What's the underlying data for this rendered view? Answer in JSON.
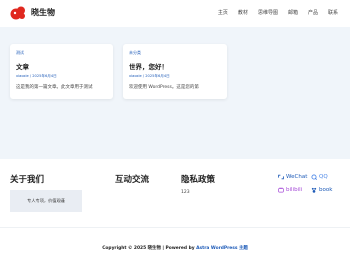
{
  "site": {
    "name": "晓生物"
  },
  "nav": {
    "items": [
      "主页",
      "教材",
      "思维导图",
      "邮箱",
      "产品",
      "联系"
    ]
  },
  "posts": [
    {
      "category": "测试",
      "title": "文章",
      "meta": "xiaoxie / 2025年6月4日",
      "excerpt": "这是我的第一篇文章。此文章用于测试"
    },
    {
      "category": "未分类",
      "title": "世界，您好！",
      "meta": "xiaoxie / 2025年6月4日",
      "excerpt": "欢迎使用 WordPress。这是您的第"
    }
  ],
  "footer": {
    "about": {
      "title": "关于我们",
      "text": "专人专项，价值观谨"
    },
    "interact": {
      "title": "互动交流"
    },
    "privacy": {
      "title": "隐私政策",
      "value": "123"
    },
    "social": {
      "wechat": "WeChat",
      "qq": "QQ",
      "bilibili": "bilibili",
      "book": "book"
    },
    "copyright_prefix": "Copyright © 2025 晓生物 | Powered by ",
    "copyright_link": "Astra WordPress 主题"
  },
  "colors": {
    "accent": "#1e5bb8",
    "logo": "#e0281f",
    "wechat": "#1e5bb8",
    "qq": "#4a86e8",
    "bilibili": "#a54ad8",
    "book": "#1e5bb8"
  }
}
